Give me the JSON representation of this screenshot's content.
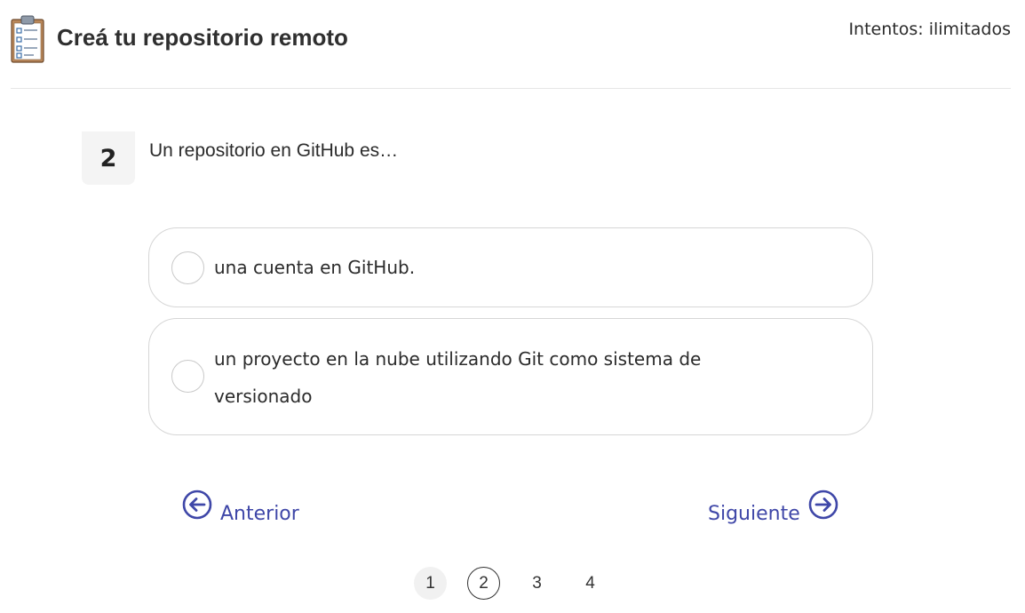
{
  "header": {
    "icon": "clipboard-checklist-icon",
    "title": "Creá tu repositorio remoto",
    "attempts": "Intentos: ilimitados"
  },
  "question": {
    "number": "2",
    "text": "Un repositorio en GitHub es…",
    "options": [
      {
        "label": "una cuenta en GitHub."
      },
      {
        "label": "un proyecto en la nube utilizando Git como sistema de versionado"
      }
    ]
  },
  "navigation": {
    "prev_label": "Anterior",
    "next_label": "Siguiente",
    "prev_icon": "arrow-left-circle-icon",
    "next_icon": "arrow-right-circle-icon",
    "accent_color": "#3f47a8"
  },
  "pagination": {
    "pages": [
      "1",
      "2",
      "3",
      "4"
    ],
    "current": "2"
  }
}
